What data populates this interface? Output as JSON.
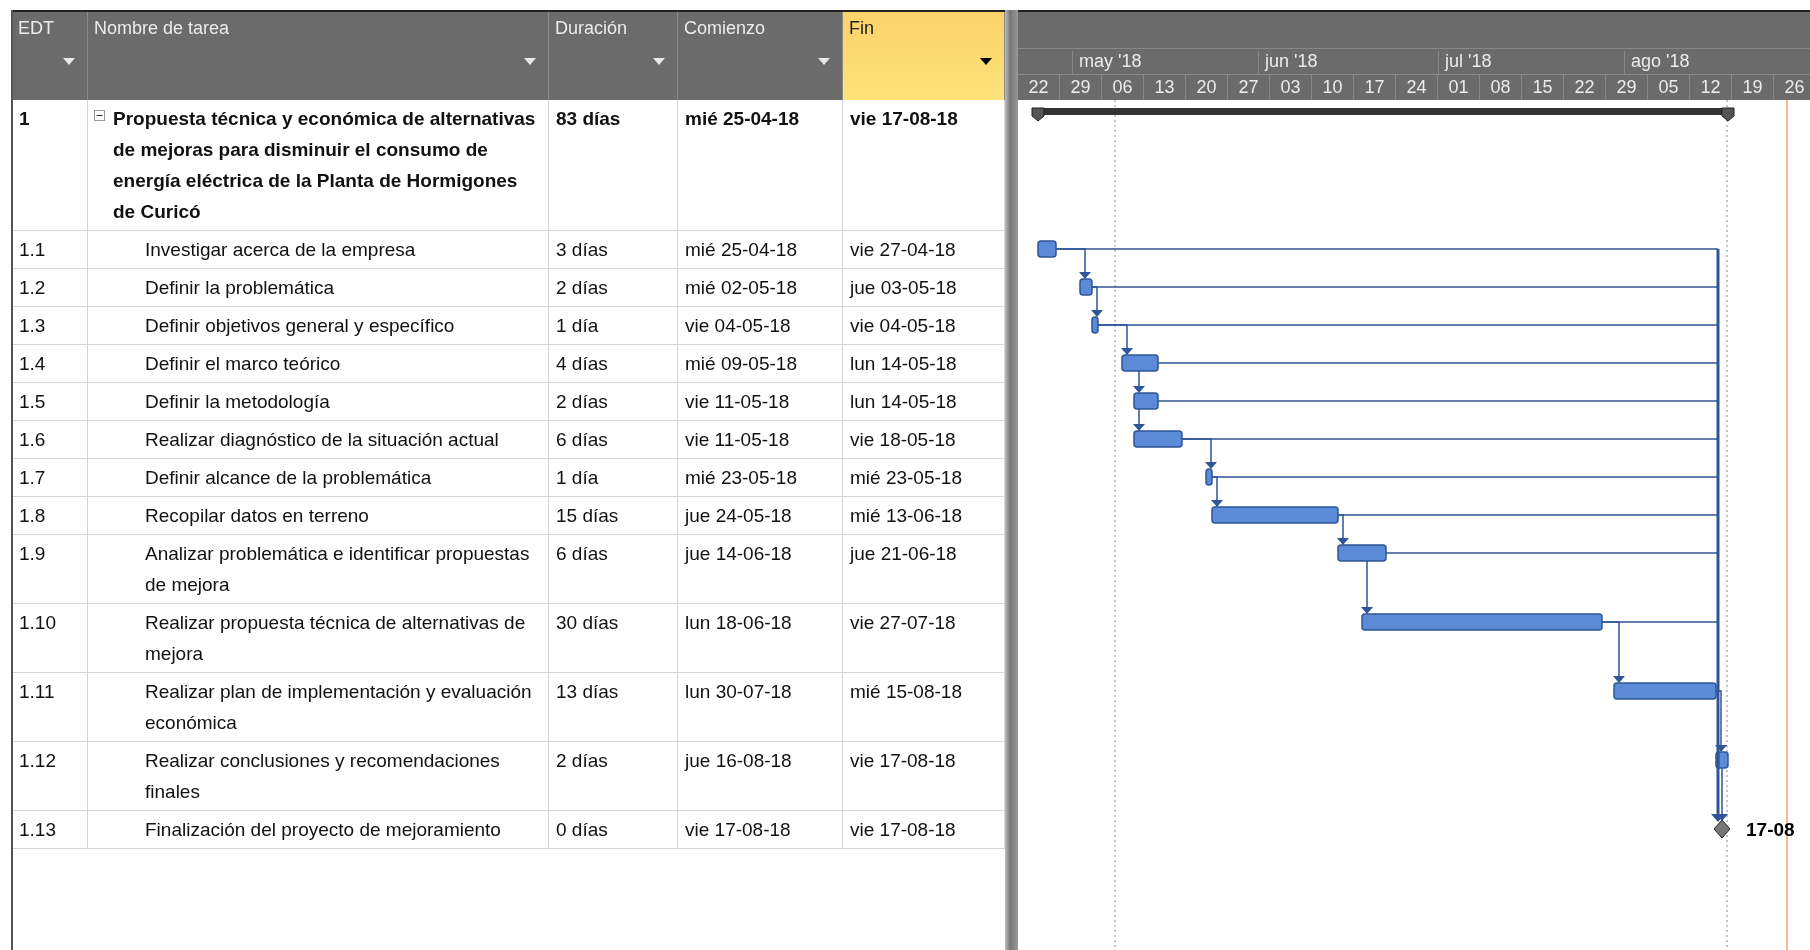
{
  "columns": [
    {
      "label": "EDT",
      "selected": false
    },
    {
      "label": "Nombre de tarea",
      "selected": false
    },
    {
      "label": "Duración",
      "selected": false
    },
    {
      "label": "Comienzo",
      "selected": false
    },
    {
      "label": "Fin",
      "selected": true
    }
  ],
  "timescale": {
    "months": [
      "may '18",
      "jun '18",
      "jul '18",
      "ago '18"
    ],
    "weeks": [
      "22",
      "29",
      "06",
      "13",
      "20",
      "27",
      "03",
      "10",
      "17",
      "24",
      "01",
      "08",
      "15",
      "22",
      "29",
      "05",
      "12",
      "19",
      "26"
    ]
  },
  "tasks": [
    {
      "kind": "summary",
      "wbs": "1",
      "name": "Propuesta técnica y económica de alternativas de mejoras para disminuir el consumo de energía eléctrica de la Planta de Hormigones de Curicó",
      "duration": "83 días",
      "start": "mié 25-04-18",
      "finish": "vie 17-08-18",
      "expanded": true,
      "children": [
        {
          "kind": "task",
          "wbs": "1.1",
          "name": "Investigar acerca de la empresa",
          "duration": "3 días",
          "start": "mié 25-04-18",
          "finish": "vie 27-04-18"
        },
        {
          "kind": "task",
          "wbs": "1.2",
          "name": "Definir la problemática",
          "duration": "2 días",
          "start": "mié 02-05-18",
          "finish": "jue 03-05-18"
        },
        {
          "kind": "task",
          "wbs": "1.3",
          "name": "Definir objetivos general y específico",
          "duration": "1 día",
          "start": "vie 04-05-18",
          "finish": "vie 04-05-18"
        },
        {
          "kind": "task",
          "wbs": "1.4",
          "name": "Definir el marco teórico",
          "duration": "4 días",
          "start": "mié 09-05-18",
          "finish": "lun 14-05-18"
        },
        {
          "kind": "task",
          "wbs": "1.5",
          "name": "Definir la metodología",
          "duration": "2 días",
          "start": "vie 11-05-18",
          "finish": "lun 14-05-18"
        },
        {
          "kind": "task",
          "wbs": "1.6",
          "name": "Realizar diagnóstico de la situación actual",
          "duration": "6 días",
          "start": "vie 11-05-18",
          "finish": "vie 18-05-18"
        },
        {
          "kind": "task",
          "wbs": "1.7",
          "name": "Definir alcance de la problemática",
          "duration": "1 día",
          "start": "mié 23-05-18",
          "finish": "mié 23-05-18"
        },
        {
          "kind": "task",
          "wbs": "1.8",
          "name": "Recopilar datos en terreno",
          "duration": "15 días",
          "start": "jue 24-05-18",
          "finish": "mié 13-06-18"
        },
        {
          "kind": "task",
          "wbs": "1.9",
          "name": "Analizar problemática e identificar propuestas de mejora",
          "duration": "6 días",
          "start": "jue 14-06-18",
          "finish": "jue 21-06-18"
        },
        {
          "kind": "task",
          "wbs": "1.10",
          "name": "Realizar propuesta técnica de alternativas de mejora",
          "duration": "30 días",
          "start": "lun 18-06-18",
          "finish": "vie 27-07-18"
        },
        {
          "kind": "task",
          "wbs": "1.11",
          "name": "Realizar plan de implementación y evaluación económica",
          "duration": "13 días",
          "start": "lun 30-07-18",
          "finish": "mié 15-08-18"
        },
        {
          "kind": "task",
          "wbs": "1.12",
          "name": "Realizar conclusiones y recomendaciones finales",
          "duration": "2 días",
          "start": "jue 16-08-18",
          "finish": "vie 17-08-18"
        },
        {
          "kind": "milestone",
          "wbs": "1.13",
          "name": "Finalización del proyecto de mejoramiento",
          "duration": "0 días",
          "start": "vie 17-08-18",
          "finish": "vie 17-08-18",
          "bar_label": "17-08"
        }
      ]
    }
  ]
}
